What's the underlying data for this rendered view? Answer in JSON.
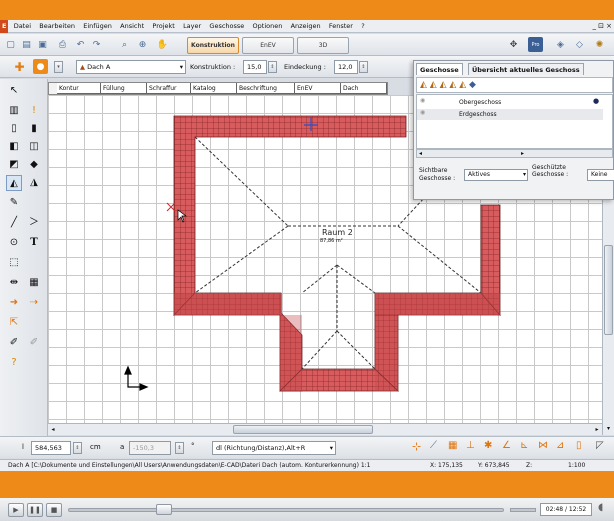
{
  "menu": [
    "Datei",
    "Bearbeiten",
    "Einfügen",
    "Ansicht",
    "Projekt",
    "Layer",
    "Geschosse",
    "Optionen",
    "Anzeigen",
    "Fenster",
    "?"
  ],
  "window_controls": [
    "_",
    "⊡",
    "×"
  ],
  "mode_tabs": {
    "konstruktion": "Konstruktion",
    "enev": "EnEV",
    "three_d": "3D"
  },
  "element_select": "Dach A",
  "konstruktion_label": "Konstruktion :",
  "konstruktion_value": "15,0",
  "eindeckung_label": "Eindeckung :",
  "eindeckung_value": "12,0",
  "catalog_columns": [
    "Kontur",
    "Füllung",
    "Schraffur",
    "Katalog",
    "Beschriftung",
    "EnEV",
    "Dach"
  ],
  "panel": {
    "tab1": "Geschosse",
    "tab2": "Übersicht aktuelles Geschoss",
    "floors": [
      "Obergeschoss",
      "Erdgeschoss"
    ],
    "visible_label": "Sichtbare Geschosse :",
    "visible_value": "Aktives",
    "protected_label": "Geschützte Geschosse :",
    "protected_value": "Keine"
  },
  "room": {
    "name": "Raum 2",
    "area": "87,86 m²"
  },
  "coords": {
    "l_label": "l",
    "l_value": "584,563",
    "unit_cm": "cm",
    "a_label": "a",
    "a_value": "-150,3",
    "unit_deg": "°",
    "mode": "dl (Richtung/Distanz),Alt+R"
  },
  "status": {
    "path": "Dach A [C:\\Dokumente und Einstellungen\\All Users\\Anwendungsdaten\\E-CAD\\Dateri Dach (autom. Konturerkennung) 1:1",
    "x": "X: 175,135",
    "y": "Y: 673,845",
    "z": "Z:",
    "scale": "1:100"
  },
  "player": {
    "time": "02:48 / 12:52"
  },
  "colors": {
    "wall": "#d85b5d",
    "wall_dark": "#8a2a2c",
    "accent": "#ee8a18"
  }
}
